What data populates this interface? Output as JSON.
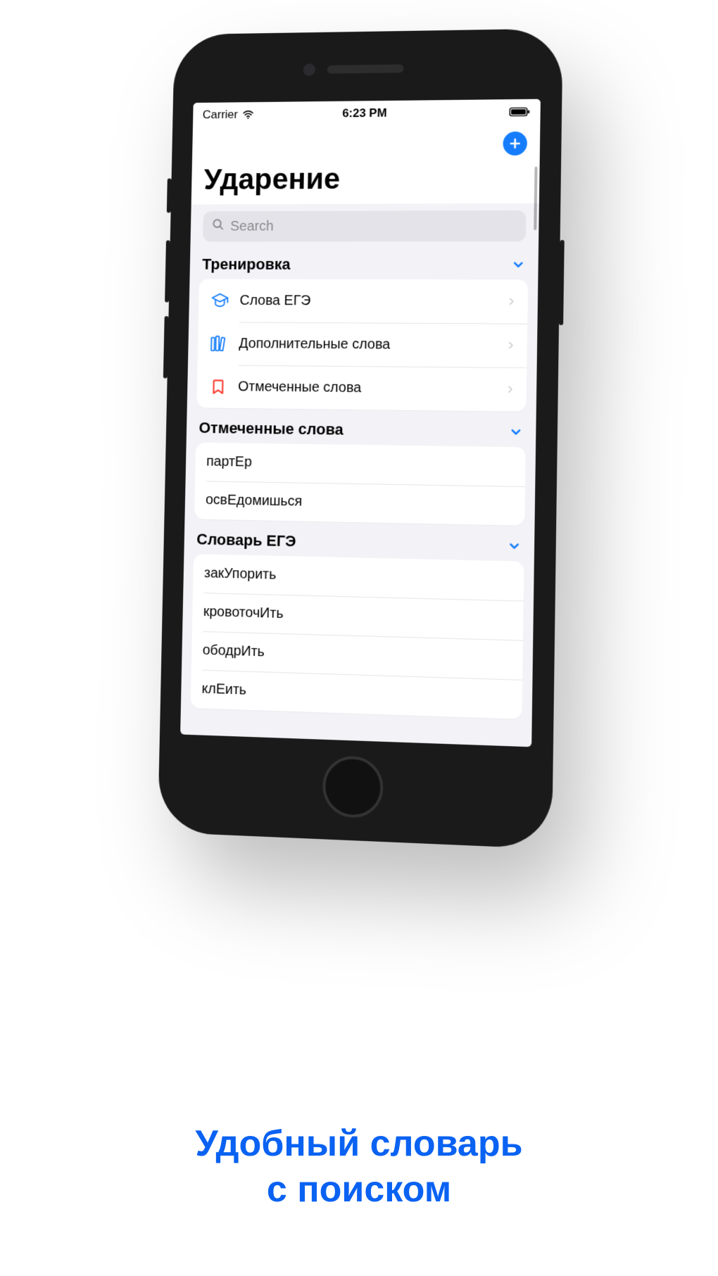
{
  "statusbar": {
    "carrier": "Carrier",
    "time": "6:23 PM"
  },
  "header": {
    "title": "Ударение"
  },
  "search": {
    "placeholder": "Search"
  },
  "sections": {
    "training": {
      "title": "Тренировка",
      "items": [
        {
          "label": "Слова ЕГЭ"
        },
        {
          "label": "Дополнительные слова"
        },
        {
          "label": "Отмеченные слова"
        }
      ]
    },
    "marked": {
      "title": "Отмеченные слова",
      "words": [
        "партЕр",
        "освЕдомишься"
      ]
    },
    "ege": {
      "title": "Словарь ЕГЭ",
      "words": [
        "закУпорить",
        "кровоточИть",
        "ободрИть",
        "клЕить"
      ]
    }
  },
  "promo": {
    "line1": "Удобный словарь",
    "line2": "с поиском"
  }
}
